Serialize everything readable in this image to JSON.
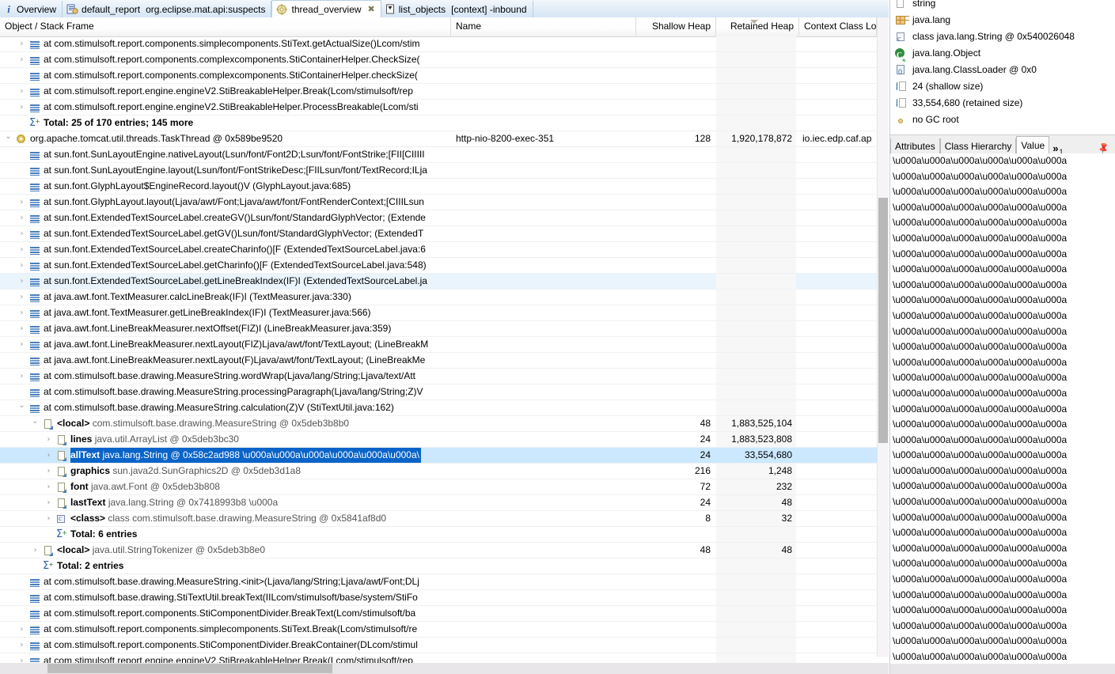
{
  "tabs": [
    {
      "label": "Overview",
      "icon": "info-icon",
      "active": false,
      "closable": false
    },
    {
      "label": "default_report",
      "sublabel": "org.eclipse.mat.api:suspects",
      "icon": "report-icon",
      "active": false,
      "closable": false
    },
    {
      "label": "thread_overview",
      "icon": "threads-icon",
      "active": true,
      "closable": true,
      "close": "✖"
    },
    {
      "label": "list_objects",
      "sublabel": "[context] -inbound",
      "icon": "list-icon",
      "active": false,
      "closable": false
    }
  ],
  "table": {
    "columns": [
      {
        "key": "object",
        "label": "Object / Stack Frame"
      },
      {
        "key": "name",
        "label": "Name"
      },
      {
        "key": "shallow",
        "label": "Shallow Heap"
      },
      {
        "key": "retained",
        "label": "Retained Heap"
      },
      {
        "key": "ccl",
        "label": "Context Class Lo"
      }
    ],
    "sorted_column": "retained",
    "rows": [
      {
        "indent": 1,
        "twisty": "collapsed",
        "icon": "stack-frame-icon",
        "text": "at com.stimulsoft.report.components.simplecomponents.StiText.getActualSize()Lcom/stim",
        "name": "",
        "shallow": "",
        "retained": "",
        "ccl": ""
      },
      {
        "indent": 1,
        "twisty": "collapsed",
        "icon": "stack-frame-icon",
        "text": "at com.stimulsoft.report.components.complexcomponents.StiContainerHelper.CheckSize(",
        "name": "",
        "shallow": "",
        "retained": "",
        "ccl": ""
      },
      {
        "indent": 1,
        "twisty": "none",
        "icon": "stack-frame-icon",
        "text": "at com.stimulsoft.report.components.complexcomponents.StiContainerHelper.checkSize(",
        "name": "",
        "shallow": "",
        "retained": "",
        "ccl": ""
      },
      {
        "indent": 1,
        "twisty": "collapsed",
        "icon": "stack-frame-icon",
        "text": "at com.stimulsoft.report.engine.engineV2.StiBreakableHelper.Break(Lcom/stimulsoft/rep",
        "name": "",
        "shallow": "",
        "retained": "",
        "ccl": ""
      },
      {
        "indent": 1,
        "twisty": "collapsed",
        "icon": "stack-frame-icon",
        "text": "at com.stimulsoft.report.engine.engineV2.StiBreakableHelper.ProcessBreakable(Lcom/sti",
        "name": "",
        "shallow": "",
        "retained": "",
        "ccl": ""
      },
      {
        "indent": 1,
        "twisty": "none",
        "icon": "total-icon",
        "text": "Total: 25 of 170 entries; 145 more",
        "bold": true,
        "name": "",
        "shallow": "",
        "retained": "",
        "ccl": ""
      },
      {
        "indent": 0,
        "twisty": "expanded",
        "icon": "thread-icon",
        "text": "org.apache.tomcat.util.threads.TaskThread @ 0x589be9520",
        "name": "http-nio-8200-exec-351",
        "shallow": "128",
        "retained": "1,920,178,872",
        "ccl": "io.iec.edp.caf.ap"
      },
      {
        "indent": 1,
        "twisty": "none",
        "icon": "stack-frame-icon",
        "text": "at sun.font.SunLayoutEngine.nativeLayout(Lsun/font/Font2D;Lsun/font/FontStrike;[FII[CIIIII",
        "name": "",
        "shallow": "",
        "retained": "",
        "ccl": ""
      },
      {
        "indent": 1,
        "twisty": "none",
        "icon": "stack-frame-icon",
        "text": "at sun.font.SunLayoutEngine.layout(Lsun/font/FontStrikeDesc;[FIILsun/font/TextRecord;ILja",
        "name": "",
        "shallow": "",
        "retained": "",
        "ccl": ""
      },
      {
        "indent": 1,
        "twisty": "none",
        "icon": "stack-frame-icon",
        "text": "at sun.font.GlyphLayout$EngineRecord.layout()V (GlyphLayout.java:685)",
        "name": "",
        "shallow": "",
        "retained": "",
        "ccl": ""
      },
      {
        "indent": 1,
        "twisty": "collapsed",
        "icon": "stack-frame-icon",
        "text": "at sun.font.GlyphLayout.layout(Ljava/awt/Font;Ljava/awt/font/FontRenderContext;[CIIILsun",
        "name": "",
        "shallow": "",
        "retained": "",
        "ccl": ""
      },
      {
        "indent": 1,
        "twisty": "collapsed",
        "icon": "stack-frame-icon",
        "text": "at sun.font.ExtendedTextSourceLabel.createGV()Lsun/font/StandardGlyphVector; (Extende",
        "name": "",
        "shallow": "",
        "retained": "",
        "ccl": ""
      },
      {
        "indent": 1,
        "twisty": "collapsed",
        "icon": "stack-frame-icon",
        "text": "at sun.font.ExtendedTextSourceLabel.getGV()Lsun/font/StandardGlyphVector; (ExtendedT",
        "name": "",
        "shallow": "",
        "retained": "",
        "ccl": ""
      },
      {
        "indent": 1,
        "twisty": "collapsed",
        "icon": "stack-frame-icon",
        "text": "at sun.font.ExtendedTextSourceLabel.createCharinfo()[F (ExtendedTextSourceLabel.java:6",
        "name": "",
        "shallow": "",
        "retained": "",
        "ccl": ""
      },
      {
        "indent": 1,
        "twisty": "collapsed",
        "icon": "stack-frame-icon",
        "text": "at sun.font.ExtendedTextSourceLabel.getCharinfo()[F (ExtendedTextSourceLabel.java:548)",
        "name": "",
        "shallow": "",
        "retained": "",
        "ccl": ""
      },
      {
        "indent": 1,
        "twisty": "collapsed",
        "icon": "stack-frame-icon",
        "text": "at sun.font.ExtendedTextSourceLabel.getLineBreakIndex(IF)I (ExtendedTextSourceLabel.ja",
        "name": "",
        "shallow": "",
        "retained": "",
        "ccl": "",
        "hover": true
      },
      {
        "indent": 1,
        "twisty": "collapsed",
        "icon": "stack-frame-icon",
        "text": "at java.awt.font.TextMeasurer.calcLineBreak(IF)I (TextMeasurer.java:330)",
        "name": "",
        "shallow": "",
        "retained": "",
        "ccl": ""
      },
      {
        "indent": 1,
        "twisty": "collapsed",
        "icon": "stack-frame-icon",
        "text": "at java.awt.font.TextMeasurer.getLineBreakIndex(IF)I (TextMeasurer.java:566)",
        "name": "",
        "shallow": "",
        "retained": "",
        "ccl": ""
      },
      {
        "indent": 1,
        "twisty": "collapsed",
        "icon": "stack-frame-icon",
        "text": "at java.awt.font.LineBreakMeasurer.nextOffset(FIZ)I (LineBreakMeasurer.java:359)",
        "name": "",
        "shallow": "",
        "retained": "",
        "ccl": ""
      },
      {
        "indent": 1,
        "twisty": "collapsed",
        "icon": "stack-frame-icon",
        "text": "at java.awt.font.LineBreakMeasurer.nextLayout(FIZ)Ljava/awt/font/TextLayout; (LineBreakM",
        "name": "",
        "shallow": "",
        "retained": "",
        "ccl": ""
      },
      {
        "indent": 1,
        "twisty": "none",
        "icon": "stack-frame-icon",
        "text": "at java.awt.font.LineBreakMeasurer.nextLayout(F)Ljava/awt/font/TextLayout; (LineBreakMe",
        "name": "",
        "shallow": "",
        "retained": "",
        "ccl": ""
      },
      {
        "indent": 1,
        "twisty": "collapsed",
        "icon": "stack-frame-icon",
        "text": "at com.stimulsoft.base.drawing.MeasureString.wordWrap(Ljava/lang/String;Ljava/text/Att",
        "name": "",
        "shallow": "",
        "retained": "",
        "ccl": ""
      },
      {
        "indent": 1,
        "twisty": "none",
        "icon": "stack-frame-icon",
        "text": "at com.stimulsoft.base.drawing.MeasureString.processingParagraph(Ljava/lang/String;Z)V",
        "name": "",
        "shallow": "",
        "retained": "",
        "ccl": ""
      },
      {
        "indent": 1,
        "twisty": "expanded",
        "icon": "stack-frame-icon",
        "text": "at com.stimulsoft.base.drawing.MeasureString.calculation(Z)V (StiTextUtil.java:162)",
        "name": "",
        "shallow": "",
        "retained": "",
        "ccl": ""
      },
      {
        "indent": 2,
        "twisty": "expanded",
        "icon": "object-icon",
        "prefix": "<local>",
        "text": "com.stimulsoft.base.drawing.MeasureString @ 0x5deb3b8b0",
        "name": "",
        "shallow": "48",
        "retained": "1,883,525,104",
        "ccl": ""
      },
      {
        "indent": 3,
        "twisty": "collapsed",
        "icon": "object-icon",
        "prefix": "lines",
        "text": "java.util.ArrayList @ 0x5deb3bc30",
        "name": "",
        "shallow": "24",
        "retained": "1,883,523,808",
        "ccl": ""
      },
      {
        "indent": 3,
        "twisty": "collapsed",
        "icon": "object-icon",
        "prefix": "allText",
        "text": "java.lang.String @ 0x58c2ad988  \\u000a\\u000a\\u000a\\u000a\\u000a\\u000a\\",
        "name": "",
        "shallow": "24",
        "retained": "33,554,680",
        "ccl": "",
        "selected": true
      },
      {
        "indent": 3,
        "twisty": "collapsed",
        "icon": "object-icon",
        "prefix": "graphics",
        "text": "sun.java2d.SunGraphics2D @ 0x5deb3d1a8",
        "name": "",
        "shallow": "216",
        "retained": "1,248",
        "ccl": ""
      },
      {
        "indent": 3,
        "twisty": "collapsed",
        "icon": "object-icon",
        "prefix": "font",
        "text": "java.awt.Font @ 0x5deb3b808",
        "name": "",
        "shallow": "72",
        "retained": "232",
        "ccl": ""
      },
      {
        "indent": 3,
        "twisty": "collapsed",
        "icon": "object-icon",
        "prefix": "lastText",
        "text": "java.lang.String @ 0x7418993b8  \\u000a",
        "name": "",
        "shallow": "24",
        "retained": "48",
        "ccl": ""
      },
      {
        "indent": 3,
        "twisty": "collapsed",
        "icon": "class-icon",
        "prefix": "<class>",
        "text": "class com.stimulsoft.base.drawing.MeasureString @ 0x5841af8d0",
        "name": "",
        "shallow": "8",
        "retained": "32",
        "ccl": ""
      },
      {
        "indent": 3,
        "twisty": "none",
        "icon": "total-icon",
        "text": "Total: 6 entries",
        "bold": true,
        "name": "",
        "shallow": "",
        "retained": "",
        "ccl": ""
      },
      {
        "indent": 2,
        "twisty": "collapsed",
        "icon": "object-icon",
        "prefix": "<local>",
        "text": "java.util.StringTokenizer @ 0x5deb3b8e0",
        "name": "",
        "shallow": "48",
        "retained": "48",
        "ccl": ""
      },
      {
        "indent": 2,
        "twisty": "none",
        "icon": "total-icon",
        "text": "Total: 2 entries",
        "bold": true,
        "name": "",
        "shallow": "",
        "retained": "",
        "ccl": ""
      },
      {
        "indent": 1,
        "twisty": "none",
        "icon": "stack-frame-icon",
        "text": "at com.stimulsoft.base.drawing.MeasureString.<init>(Ljava/lang/String;Ljava/awt/Font;DLj",
        "name": "",
        "shallow": "",
        "retained": "",
        "ccl": ""
      },
      {
        "indent": 1,
        "twisty": "none",
        "icon": "stack-frame-icon",
        "text": "at com.stimulsoft.base.drawing.StiTextUtil.breakText(IILcom/stimulsoft/base/system/StiFo",
        "name": "",
        "shallow": "",
        "retained": "",
        "ccl": ""
      },
      {
        "indent": 1,
        "twisty": "none",
        "icon": "stack-frame-icon",
        "text": "at com.stimulsoft.report.components.StiComponentDivider.BreakText(Lcom/stimulsoft/ba",
        "name": "",
        "shallow": "",
        "retained": "",
        "ccl": ""
      },
      {
        "indent": 1,
        "twisty": "collapsed",
        "icon": "stack-frame-icon",
        "text": "at com.stimulsoft.report.components.simplecomponents.StiText.Break(Lcom/stimulsoft/re",
        "name": "",
        "shallow": "",
        "retained": "",
        "ccl": ""
      },
      {
        "indent": 1,
        "twisty": "collapsed",
        "icon": "stack-frame-icon",
        "text": "at com.stimulsoft.report.components.StiComponentDivider.BreakContainer(DLcom/stimul",
        "name": "",
        "shallow": "",
        "retained": "",
        "ccl": ""
      },
      {
        "indent": 1,
        "twisty": "collapsed",
        "icon": "stack-frame-icon",
        "text": "at com.stimulsoft.report.engine.engineV2.StiBreakableHelper.Break(Lcom/stimulsoft/rep",
        "name": "",
        "shallow": "",
        "retained": "",
        "ccl": ""
      }
    ]
  },
  "inspector": {
    "rows": [
      {
        "icon": "string-page-icon",
        "label": "string"
      },
      {
        "icon": "package-icon",
        "label": "java.lang"
      },
      {
        "icon": "class-icon",
        "label": "class java.lang.String @ 0x540026048"
      },
      {
        "icon": "superclass-icon",
        "label": "java.lang.Object"
      },
      {
        "icon": "classloader-icon",
        "label": "java.lang.ClassLoader @ 0x0"
      },
      {
        "icon": "shallow-size-icon",
        "label": "24 (shallow size)"
      },
      {
        "icon": "retained-size-icon",
        "label": "33,554,680 (retained size)"
      },
      {
        "icon": "gc-root-icon",
        "label": "no GC root"
      }
    ],
    "tabs": [
      {
        "label": "Attributes",
        "active": false
      },
      {
        "label": "Class Hierarchy",
        "active": false
      },
      {
        "label": "Value",
        "active": true
      }
    ],
    "overflow": {
      "chevrons": "»",
      "count": "1"
    },
    "pin_icon": "pin-icon",
    "value_line": "\\u000a\\u000a\\u000a\\u000a\\u000a\\u000a",
    "value_line_count": 33
  },
  "colors": {
    "selection": "#0a64c8",
    "selection_row": "#cce8ff",
    "hover_row": "#eaf4fd",
    "accent": "#4a7ebb",
    "tabbar_top": "#f3f7fb",
    "tabbar_bottom": "#d6e6f5"
  }
}
